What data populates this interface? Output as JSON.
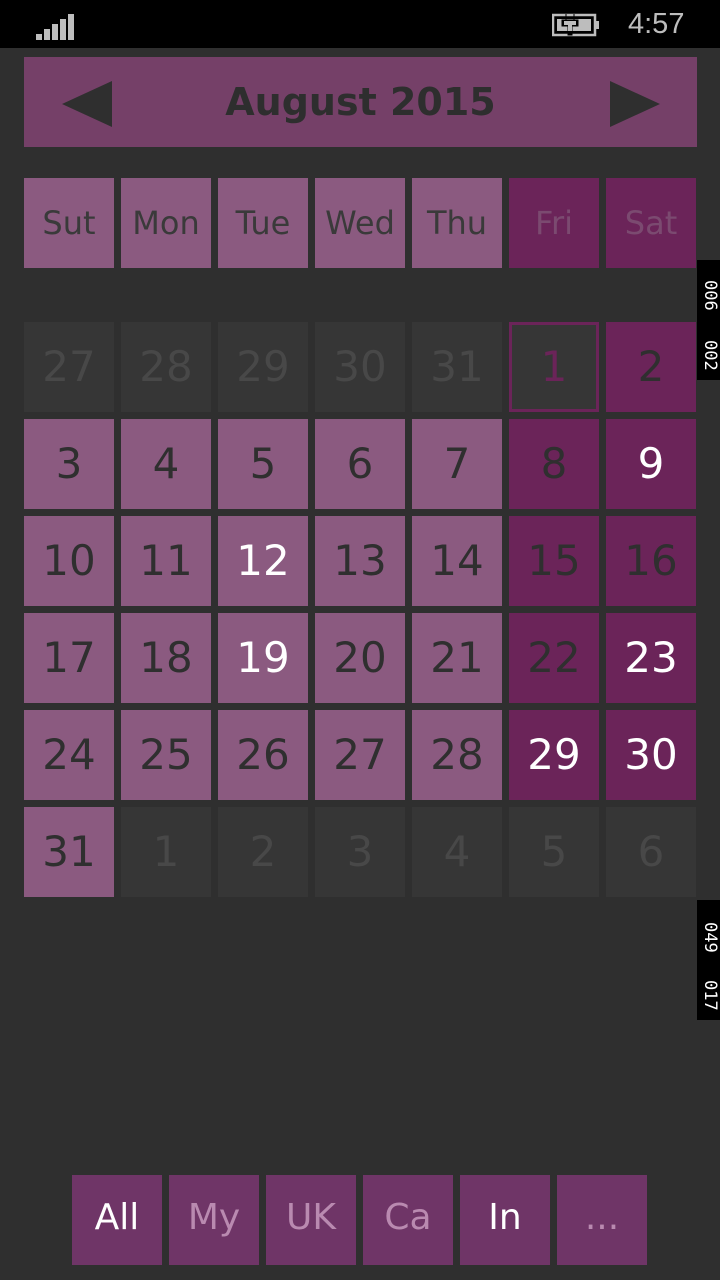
{
  "status_bar": {
    "time": "4:57",
    "signal_icon": "signal-strength-icon",
    "battery_icon": "battery-charging-icon"
  },
  "calendar": {
    "title": "August 2015",
    "prev_icon": "triangle-left-icon",
    "next_icon": "triangle-right-icon",
    "day_names": [
      "Sut",
      "Mon",
      "Tue",
      "Wed",
      "Thu",
      "Fri",
      "Sat"
    ],
    "weeks": [
      [
        "27",
        "28",
        "29",
        "30",
        "31",
        "1",
        "2"
      ],
      [
        "3",
        "4",
        "5",
        "6",
        "7",
        "8",
        "9"
      ],
      [
        "10",
        "11",
        "12",
        "13",
        "14",
        "15",
        "16"
      ],
      [
        "17",
        "18",
        "19",
        "20",
        "21",
        "22",
        "23"
      ],
      [
        "24",
        "25",
        "26",
        "27",
        "28",
        "29",
        "30"
      ],
      [
        "31",
        "1",
        "2",
        "3",
        "4",
        "5",
        "6"
      ]
    ]
  },
  "side_tabs": {
    "top": [
      "006",
      "002"
    ],
    "bottom": [
      "049",
      "017"
    ]
  },
  "filters": [
    "All",
    "My",
    "UK",
    "Ca",
    "In",
    "..."
  ],
  "colors": {
    "accent": "#754068",
    "weekday_cell": "#8b5a80",
    "weekend_cell": "#6b2459",
    "background": "#2f2f2f"
  }
}
